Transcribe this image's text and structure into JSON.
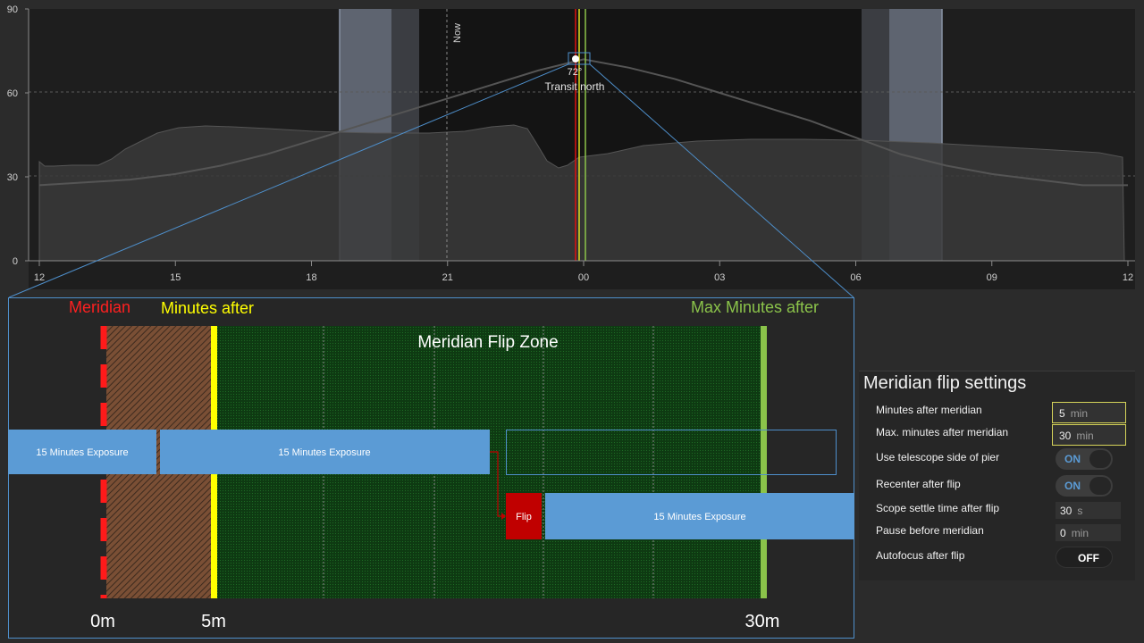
{
  "chart_data": {
    "type": "line",
    "x_ticks": [
      "12",
      "15",
      "18",
      "21",
      "00",
      "03",
      "06",
      "09",
      "12"
    ],
    "y_ticks": [
      "90",
      "60",
      "30",
      "0"
    ],
    "ylim": [
      0,
      90
    ],
    "now_label": "Now",
    "transit_altitude": "72°",
    "transit_label": "Transit north",
    "series": [
      {
        "x": [
          12,
          13,
          14,
          15,
          16,
          17,
          18,
          19,
          20,
          21,
          22,
          23,
          24,
          25,
          26,
          27,
          28,
          29,
          30,
          31,
          32,
          33,
          34,
          35,
          36
        ],
        "y": [
          27,
          28,
          29,
          31,
          34,
          38,
          43,
          48,
          53,
          58,
          63,
          68,
          72,
          69,
          65,
          60,
          55,
          50,
          44,
          38,
          34,
          31,
          29,
          27,
          27
        ]
      }
    ]
  },
  "zone": {
    "meridian_label": "Meridian",
    "minutes_after_label": "Minutes after",
    "max_minutes_label": "Max Minutes after",
    "zone_title": "Meridian Flip Zone",
    "exposure_label": "15 Minutes Exposure",
    "flip_label": "Flip",
    "scale": [
      "0m",
      "5m",
      "30m"
    ]
  },
  "settings": {
    "title": "Meridian flip settings",
    "rows": [
      {
        "label": "Minutes after meridian",
        "value": "5",
        "unit": "min"
      },
      {
        "label": "Max. minutes after meridian",
        "value": "30",
        "unit": "min"
      },
      {
        "label": "Use telescope side of pier",
        "toggle": "ON"
      },
      {
        "label": "Recenter after flip",
        "toggle": "ON"
      },
      {
        "label": "Scope settle time after flip",
        "value": "30",
        "unit": "s"
      },
      {
        "label": "Pause before meridian",
        "value": "0",
        "unit": "min"
      },
      {
        "label": "Autofocus after flip",
        "toggle": "OFF"
      }
    ]
  }
}
